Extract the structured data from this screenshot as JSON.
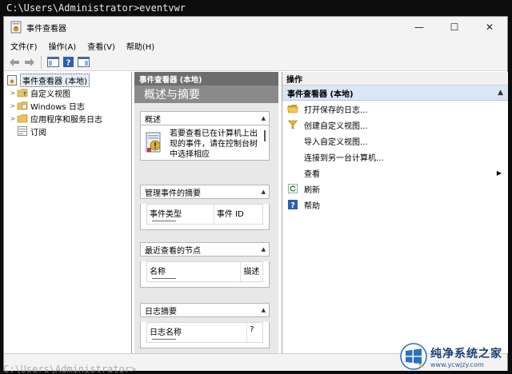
{
  "terminal": {
    "top_line": "C:\\Users\\Administrator>eventvwr",
    "bottom_line": "C:\\Users\\Administrator>"
  },
  "window": {
    "title": "事件查看器",
    "minimize_glyph": "—",
    "maximize_glyph": "☐",
    "close_glyph": "✕"
  },
  "menu": {
    "file": "文件(F)",
    "action": "操作(A)",
    "view": "查看(V)",
    "help": "帮助(H)"
  },
  "tree": {
    "root": "事件查看器 (本地)",
    "items": [
      {
        "label": "自定义视图"
      },
      {
        "label": "Windows 日志"
      },
      {
        "label": "应用程序和服务日志"
      },
      {
        "label": "订阅"
      }
    ]
  },
  "middle": {
    "header": "事件查看器 (本地)",
    "overview_title": "概述与摘要",
    "sections": {
      "overview": {
        "title": "概述",
        "text": "若要查看已在计算机上出现的事件，请在控制台树中选择相应"
      },
      "summary": {
        "title": "管理事件的摘要",
        "col1": "事件类型",
        "col2": "事件 ID"
      },
      "recent": {
        "title": "最近查看的节点",
        "col1": "名称",
        "col2": "描述"
      },
      "logs": {
        "title": "日志摘要",
        "col1": "日志名称",
        "col2": "?"
      }
    }
  },
  "actions": {
    "header": "操作",
    "group": "事件查看器 (本地)",
    "items": [
      {
        "label": "打开保存的日志..."
      },
      {
        "label": "创建自定义视图..."
      },
      {
        "label": "导入自定义视图..."
      },
      {
        "label": "连接到另一台计算机..."
      },
      {
        "label": "查看"
      },
      {
        "label": "刷新"
      },
      {
        "label": "帮助"
      }
    ]
  },
  "watermark": {
    "title": "纯净系统之家",
    "url": "www.ycwjzy.com"
  },
  "colors": {
    "terminal_bg": "#0c0c0c",
    "mid_header": "#6d6d6d",
    "action_group": "#d9e6f5"
  }
}
